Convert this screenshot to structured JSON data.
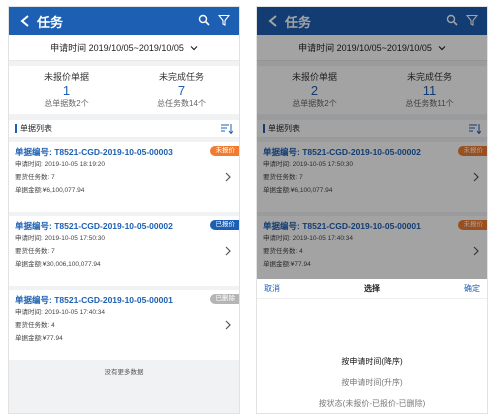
{
  "header": {
    "title": "任务"
  },
  "date_bar": {
    "range": "申请时间 2019/10/05~2019/10/05"
  },
  "left": {
    "stats": [
      {
        "label": "未报价单据",
        "value": "1",
        "sub": "总单据数2个"
      },
      {
        "label": "未完成任务",
        "value": "7",
        "sub": "总任务数14个"
      }
    ],
    "list_title": "单据列表",
    "cards": [
      {
        "no": "单据编号: T8521-CGD-2019-10-05-00003",
        "time": "申请时间: 2019-10-05 18:19:20",
        "tasks": "要货任务数: 7",
        "amount": "单据金额:¥6,100,077.94",
        "badge": "未报价",
        "badge_color": "#f07c32"
      },
      {
        "no": "单据编号: T8521-CGD-2019-10-05-00002",
        "time": "申请时间: 2019-10-05 17:50:30",
        "tasks": "要货任务数: 7",
        "amount": "单据金额:¥30,006,100,077.94",
        "badge": "已报价",
        "badge_color": "#1d5fb3"
      },
      {
        "no": "单据编号: T8521-CGD-2019-10-05-00001",
        "time": "申请时间: 2019-10-05 17:40:34",
        "tasks": "要货任务数: 4",
        "amount": "单据金额:¥77.94",
        "badge": "已删除",
        "badge_color": "#b5b5b5"
      }
    ],
    "footer": "没有更多数据"
  },
  "right": {
    "stats": [
      {
        "label": "未报价单据",
        "value": "2",
        "sub": "总单据数2个"
      },
      {
        "label": "未完成任务",
        "value": "11",
        "sub": "总任务数11个"
      }
    ],
    "list_title": "单据列表",
    "cards": [
      {
        "no": "单据编号: T8521-CGD-2019-10-05-00002",
        "time": "申请时间: 2019-10-05 17:50:30",
        "tasks": "要货任务数: 7",
        "amount": "单据金额:¥6,100,077.94",
        "badge": "未报价",
        "badge_color": "#f07c32"
      },
      {
        "no": "单据编号: T8521-CGD-2019-10-05-00001",
        "time": "申请时间: 2019-10-05 17:40:34",
        "tasks": "要货任务数: 4",
        "amount": "单据金额:¥77.94",
        "badge": "未报价",
        "badge_color": "#f07c32"
      }
    ],
    "sheet": {
      "cancel": "取消",
      "title": "选择",
      "confirm": "确定",
      "options": [
        "按申请时间(降序)",
        "按申请时间(升序)",
        "按状态(未报价-已报价-已删除)"
      ]
    }
  }
}
